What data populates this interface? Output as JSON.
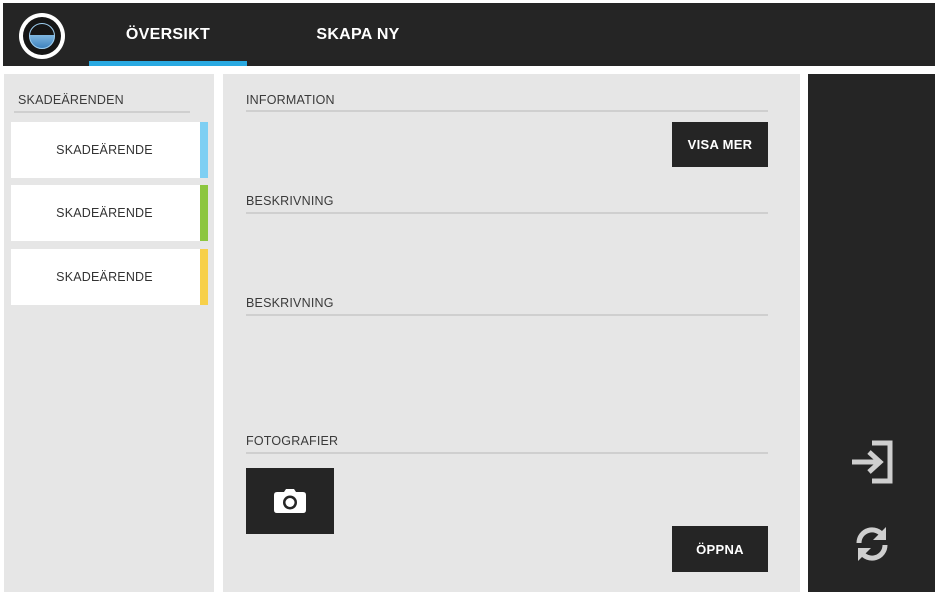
{
  "header": {
    "tabs": [
      {
        "label": "ÖVERSIKT",
        "active": true
      },
      {
        "label": "SKAPA NY",
        "active": false
      }
    ],
    "accent_color": "#29a9e1"
  },
  "sidebar": {
    "title": "SKADEÄRENDEN",
    "items": [
      {
        "label": "SKADEÄRENDE",
        "color": "#7ecff3"
      },
      {
        "label": "SKADEÄRENDE",
        "color": "#8cc63f"
      },
      {
        "label": "SKADEÄRENDE",
        "color": "#f7d04a"
      }
    ]
  },
  "main": {
    "information_label": "INFORMATION",
    "visa_mer_label": "VISA MER",
    "description_label_1": "BESKRIVNING",
    "description_label_2": "BESKRIVNING",
    "photos_label": "FOTOGRAFIER",
    "camera_icon": "camera-icon",
    "open_label": "ÖPPNA"
  },
  "right_panel": {
    "icons": [
      "login-icon",
      "refresh-icon"
    ]
  }
}
